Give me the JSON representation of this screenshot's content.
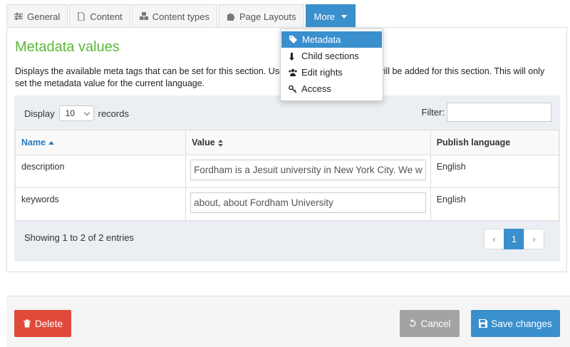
{
  "tabs": [
    {
      "label": "General",
      "icon": "sliders-icon"
    },
    {
      "label": "Content",
      "icon": "document-icon"
    },
    {
      "label": "Content types",
      "icon": "cubes-icon"
    },
    {
      "label": "Page Layouts",
      "icon": "puzzle-icon"
    }
  ],
  "more_tab": {
    "label": "More"
  },
  "dropdown": {
    "items": [
      {
        "label": "Metadata",
        "icon": "tags-icon",
        "active": true
      },
      {
        "label": "Child sections",
        "icon": "level-down-icon"
      },
      {
        "label": "Edit rights",
        "icon": "users-icon"
      },
      {
        "label": "Access",
        "icon": "key-icon"
      }
    ]
  },
  "panel": {
    "title": "Metadata values",
    "description": "Displays the available meta tags that can be set for this section. Use th                                        metadata value that will be added for this section. This will only set the metadata value for the current language."
  },
  "table_controls": {
    "display_label": "Display",
    "page_size": "10",
    "records_label": "records",
    "filter_label": "Filter:",
    "filter_value": ""
  },
  "table": {
    "columns": [
      "Name",
      "Value",
      "Publish language"
    ],
    "rows": [
      {
        "name": "description",
        "value": "Fordham is a Jesuit university in New York City. We w",
        "language": "English"
      },
      {
        "name": "keywords",
        "value": "about, about Fordham University",
        "language": "English"
      }
    ]
  },
  "pagination": {
    "info": "Showing 1 to 2 of 2 entries",
    "prev": "‹",
    "page": "1",
    "next": "›"
  },
  "footer": {
    "delete_label": "Delete",
    "cancel_label": "Cancel",
    "save_label": "Save changes"
  },
  "colors": {
    "accent": "#3a8fcd",
    "title_green": "#5cb83c",
    "delete_red": "#e04a3b",
    "cancel_gray": "#a3a3a3"
  }
}
